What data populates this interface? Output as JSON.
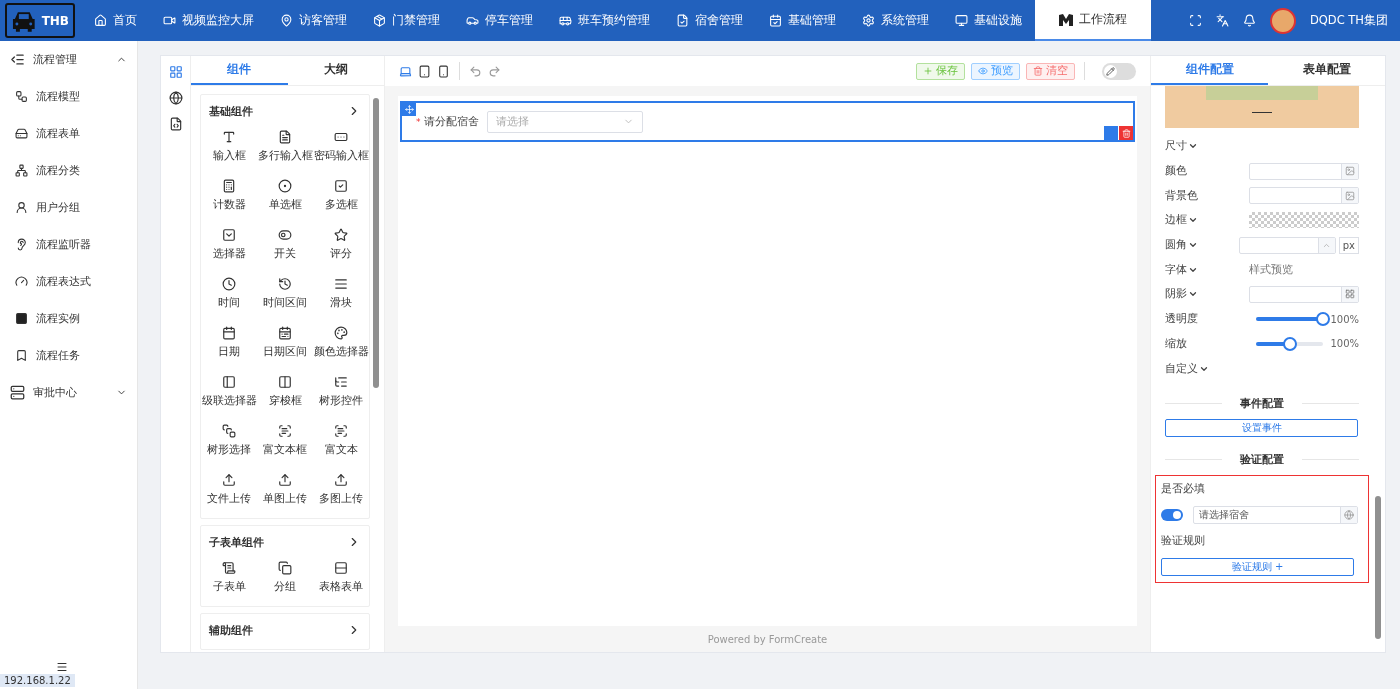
{
  "top_nav": {
    "logo": "THB",
    "items": [
      {
        "label": "首页",
        "selected": false
      },
      {
        "label": "视频监控大屏",
        "selected": false
      },
      {
        "label": "访客管理",
        "selected": false
      },
      {
        "label": "门禁管理",
        "selected": false
      },
      {
        "label": "停车管理",
        "selected": false
      },
      {
        "label": "班车预约管理",
        "selected": false
      },
      {
        "label": "宿舍管理",
        "selected": false
      },
      {
        "label": "基础管理",
        "selected": false
      },
      {
        "label": "系统管理",
        "selected": false
      },
      {
        "label": "基础设施",
        "selected": false
      },
      {
        "label": "工作流程",
        "selected": true
      }
    ],
    "user": "DQDC TH集团"
  },
  "sidebar": {
    "groups": [
      {
        "label": "流程管理",
        "expanded": true,
        "children": [
          {
            "label": "流程模型"
          },
          {
            "label": "流程表单"
          },
          {
            "label": "流程分类"
          },
          {
            "label": "用户分组"
          },
          {
            "label": "流程监听器"
          },
          {
            "label": "流程表达式"
          },
          {
            "label": "流程实例"
          },
          {
            "label": "流程任务"
          }
        ]
      },
      {
        "label": "审批中心",
        "expanded": false
      }
    ],
    "ip": "192.168.1.22"
  },
  "components": {
    "tabs": [
      {
        "label": "组件",
        "selected": true
      },
      {
        "label": "大纲",
        "selected": false
      }
    ],
    "sections": [
      {
        "title": "基础组件",
        "items": [
          "输入框",
          "多行输入框",
          "密码输入框",
          "计数器",
          "单选框",
          "多选框",
          "选择器",
          "开关",
          "评分",
          "时间",
          "时间区间",
          "滑块",
          "日期",
          "日期区间",
          "颜色选择器",
          "级联选择器",
          "穿梭框",
          "树形控件",
          "树形选择",
          "富文本框",
          "富文本",
          "文件上传",
          "单图上传",
          "多图上传"
        ]
      },
      {
        "title": "子表单组件",
        "items": [
          "子表单",
          "分组",
          "表格表单"
        ]
      },
      {
        "title": "辅助组件"
      }
    ]
  },
  "canvas": {
    "buttons": [
      {
        "label": "保存",
        "kind": "save"
      },
      {
        "label": "预览",
        "kind": "preview"
      },
      {
        "label": "清空",
        "kind": "clear"
      }
    ],
    "dark_mode": false,
    "field": {
      "label": "请分配宿舍",
      "required_mark": "*",
      "placeholder": "请选择"
    },
    "footer": "Powered by FormCreate"
  },
  "config": {
    "tabs": [
      {
        "label": "组件配置",
        "selected": true
      },
      {
        "label": "表单配置",
        "selected": false
      }
    ],
    "rows": [
      {
        "kind": "collapse",
        "label": "尺寸"
      },
      {
        "kind": "color",
        "label": "颜色"
      },
      {
        "kind": "color",
        "label": "背景色"
      },
      {
        "kind": "border",
        "label": "边框"
      },
      {
        "kind": "number",
        "label": "圆角",
        "unit": "px"
      },
      {
        "kind": "font",
        "label": "字体",
        "preview": "样式预览"
      },
      {
        "kind": "shadow",
        "label": "阴影"
      },
      {
        "kind": "slider",
        "label": "透明度",
        "level": 1,
        "reading": "100%"
      },
      {
        "kind": "slider",
        "label": "缩放",
        "level": 0.5,
        "reading": "100%"
      },
      {
        "kind": "collapse",
        "label": "自定义"
      }
    ],
    "event": {
      "title": "事件配置",
      "button": "设置事件"
    },
    "validation": {
      "title": "验证配置",
      "highlighted": true,
      "required_label": "是否必填",
      "required_on": true,
      "message": "请选择宿舍",
      "rules_label": "验证规则",
      "rules_button": "验证规则 +"
    }
  }
}
